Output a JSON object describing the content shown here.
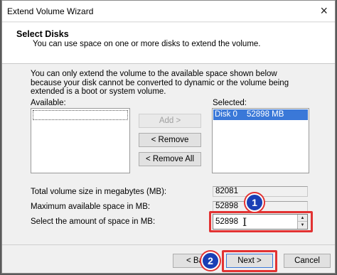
{
  "window": {
    "title": "Extend Volume Wizard",
    "close_glyph": "×"
  },
  "header": {
    "title": "Select Disks",
    "subtitle": "You can use space on one or more disks to extend the volume."
  },
  "intro": "You can only extend the volume to the available space shown below because your disk cannot be converted to dynamic or the volume being extended is a boot or system volume.",
  "available": {
    "label": "Available:",
    "items": []
  },
  "selected": {
    "label": "Selected:",
    "items": [
      {
        "disk": "Disk 0",
        "size": "52898 MB"
      }
    ]
  },
  "buttons": {
    "add": "Add >",
    "remove": "< Remove",
    "remove_all": "< Remove All",
    "back": "< Ba",
    "next": "Next >",
    "cancel": "Cancel"
  },
  "fields": {
    "total_label": "Total volume size in megabytes (MB):",
    "total_value": "82081",
    "max_label": "Maximum available space in MB:",
    "max_value": "52898",
    "amount_label": "Select the amount of space in MB:",
    "amount_value": "52898"
  },
  "annotations": {
    "badge1": "1",
    "badge2": "2",
    "accent": "#e23232",
    "badge_color": "#1a3fb5"
  },
  "icons": {
    "text_cursor": "I",
    "spin_up": "▲",
    "spin_down": "▼"
  }
}
